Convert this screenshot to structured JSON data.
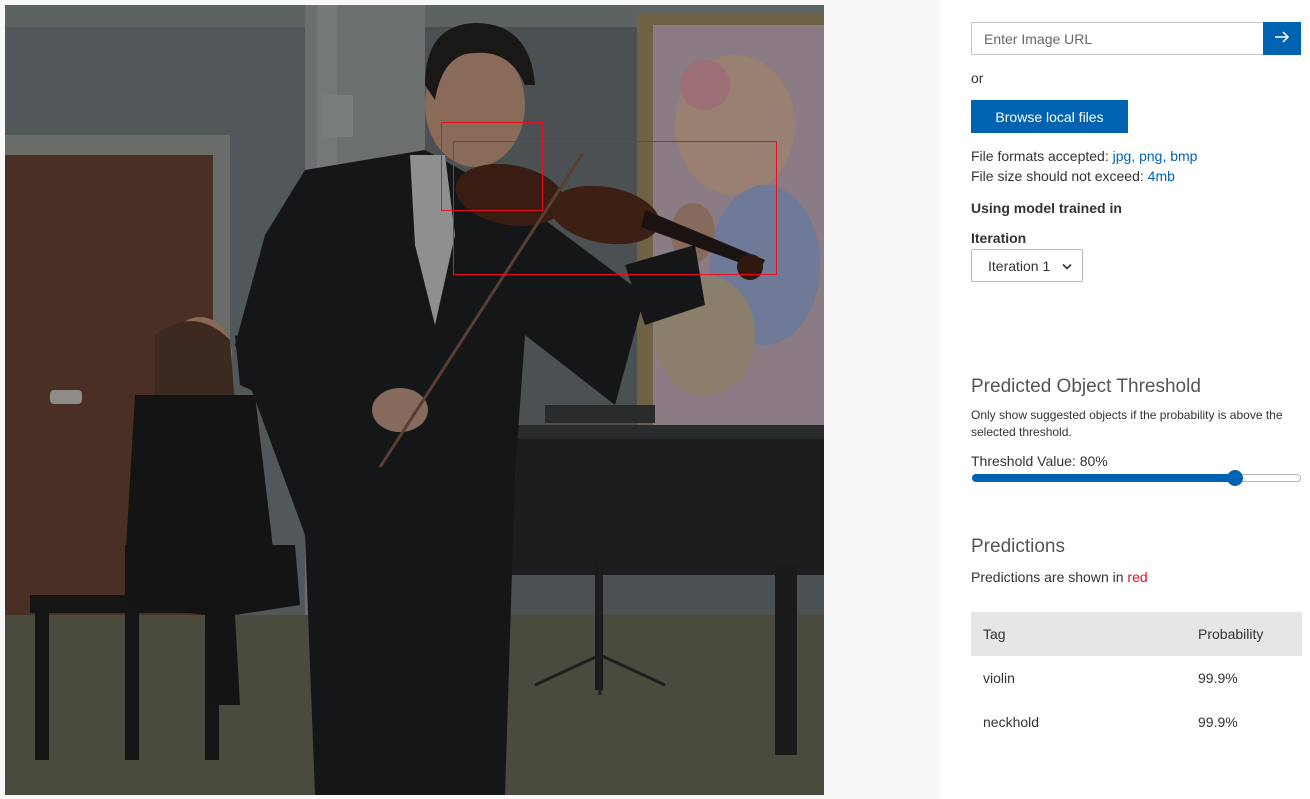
{
  "upload": {
    "url_placeholder": "Enter Image URL",
    "url_value": "",
    "go_icon": "arrow-right-icon",
    "or_label": "or",
    "browse_label": "Browse local files",
    "formats_label": "File formats accepted:",
    "formats_value": "jpg, png, bmp",
    "size_label": "File size should not exceed:",
    "size_value": "4mb"
  },
  "model": {
    "trained_label": "Using model trained in",
    "iteration_label": "Iteration",
    "iteration_selected": "Iteration 1"
  },
  "threshold": {
    "title": "Predicted Object Threshold",
    "description": "Only show suggested objects if the probability is above the selected threshold.",
    "value_label": "Threshold Value: 80%",
    "value_percent": 80
  },
  "predictions": {
    "title": "Predictions",
    "note_prefix": "Predictions are shown in",
    "note_color_word": "red",
    "columns": [
      "Tag",
      "Probability"
    ],
    "rows": [
      {
        "tag": "violin",
        "probability": "99.9%"
      },
      {
        "tag": "neckhold",
        "probability": "99.9%"
      }
    ]
  },
  "colors": {
    "accent": "#0063b1",
    "prediction_box": "#e81123"
  }
}
